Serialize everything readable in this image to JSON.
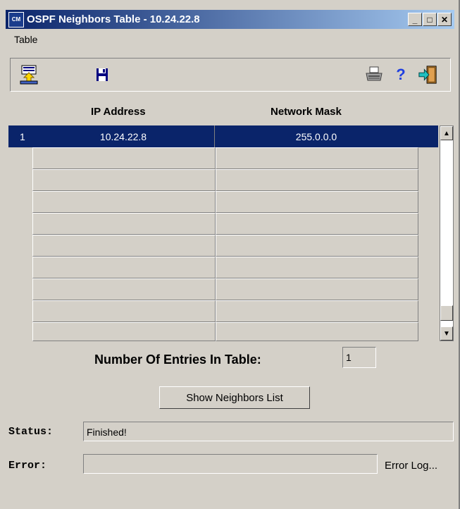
{
  "window": {
    "icon_text": "CM",
    "title": "OSPF Neighbors Table - 10.24.22.8",
    "min_label": "_",
    "max_label": "□",
    "close_label": "✕"
  },
  "menu": {
    "table_label": "Table"
  },
  "toolbar": {
    "icons": [
      "load-table-icon",
      "save-disk-icon",
      "printer-icon",
      "help-icon",
      "exit-door-icon"
    ]
  },
  "columns": {
    "ip": "IP Address",
    "mask": "Network Mask"
  },
  "rows": [
    {
      "num": "1",
      "ip": "10.24.22.8",
      "mask": "255.0.0.0"
    }
  ],
  "scrollbar": {
    "up": "▲",
    "down": "▼"
  },
  "entries": {
    "label": "Number Of Entries In Table:",
    "value": "1"
  },
  "show_button": "Show Neighbors List",
  "status": {
    "label": "Status:",
    "value": "Finished!"
  },
  "error": {
    "label": "Error:",
    "value": "",
    "log_link": "Error Log..."
  },
  "colors": {
    "selection": "#0a246a",
    "face": "#d4d0c8"
  }
}
